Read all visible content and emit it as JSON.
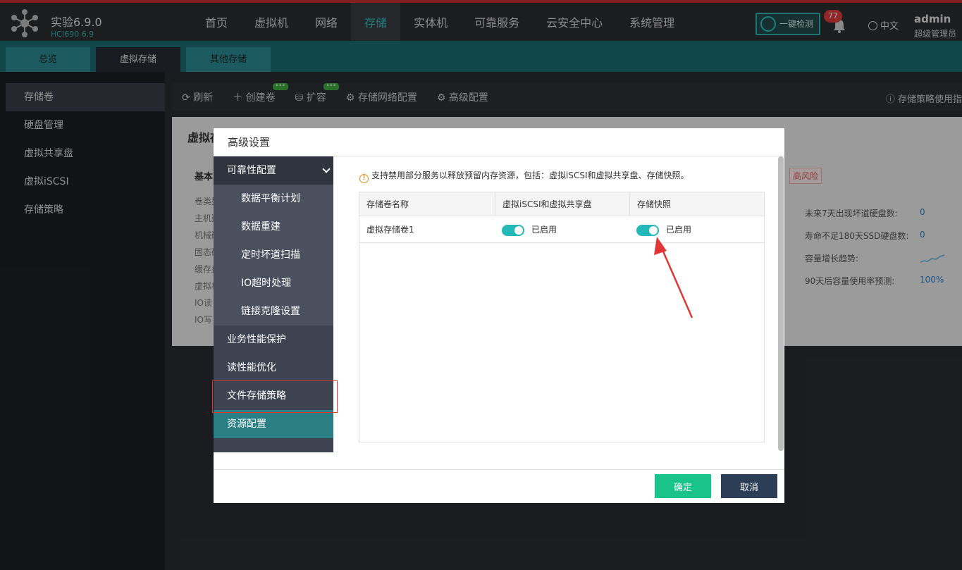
{
  "brand": {
    "title": "实验6.9.0",
    "subtitle": "HCI690 6.9"
  },
  "nav": [
    {
      "label": "首页",
      "active": false
    },
    {
      "label": "虚拟机",
      "active": false
    },
    {
      "label": "网络",
      "active": false
    },
    {
      "label": "存储",
      "active": true
    },
    {
      "label": "实体机",
      "active": false
    },
    {
      "label": "可靠服务",
      "active": false
    },
    {
      "label": "云安全中心",
      "active": false
    },
    {
      "label": "系统管理",
      "active": false
    }
  ],
  "header": {
    "detect_label": "一键检测",
    "notify_count": "77",
    "language": "中文",
    "username": "admin",
    "role": "超级管理员"
  },
  "tabs": [
    {
      "label": "总览",
      "active": false
    },
    {
      "label": "虚拟存储",
      "active": true
    },
    {
      "label": "其他存储",
      "active": false
    }
  ],
  "sidebar": [
    {
      "label": "存储卷",
      "active": true
    },
    {
      "label": "硬盘管理",
      "active": false
    },
    {
      "label": "虚拟共享盘",
      "active": false
    },
    {
      "label": "虚拟iSCSI",
      "active": false
    },
    {
      "label": "存储策略",
      "active": false
    }
  ],
  "toolbar": {
    "refresh": "刷新",
    "create": "创建卷",
    "expand": "扩容",
    "network_config": "存储网络配置",
    "advanced_config": "高级配置",
    "help": "存储策略使用指"
  },
  "background_card": {
    "title": "虚拟存",
    "section": "基本",
    "rows": [
      "卷类型",
      "主机数",
      "机械硬",
      "固态硬",
      "缓存盘",
      "虚拟机",
      "IO读",
      "IO写"
    ],
    "risk_tag": "高风险",
    "stats": [
      {
        "label": "未来7天出现坏道硬盘数:",
        "value": "0"
      },
      {
        "label": "寿命不足180天SSD硬盘数:",
        "value": "0"
      },
      {
        "label": "容量增长趋势:",
        "value": ""
      },
      {
        "label": "90天后容量使用率预测:",
        "value": "100%"
      }
    ]
  },
  "modal": {
    "title": "高级设置",
    "menu": {
      "group1": "可靠性配置",
      "sub": [
        "数据平衡计划",
        "数据重建",
        "定时坏道扫描",
        "IO超时处理",
        "链接克隆设置"
      ],
      "group2": "业务性能保护",
      "group3": "读性能优化",
      "group4": "文件存储策略",
      "group5": "资源配置"
    },
    "notice": "支持禁用部分服务以释放预留内存资源，包括：虚拟iSCSI和虚拟共享盘、存储快照。",
    "table": {
      "headers": [
        "存储卷名称",
        "虚拟iSCSI和虚拟共享盘",
        "存储快照"
      ],
      "rows": [
        {
          "name": "虚拟存储卷1",
          "iscsi_state": "已启用",
          "snapshot_state": "已启用"
        }
      ]
    },
    "ok": "确定",
    "cancel": "取消"
  },
  "colors": {
    "accent": "#2fc1c1",
    "toggle_on": "#23b9b9",
    "ok_button": "#19c38a",
    "cancel_button": "#2c3e55",
    "annotation": "#e03636"
  }
}
